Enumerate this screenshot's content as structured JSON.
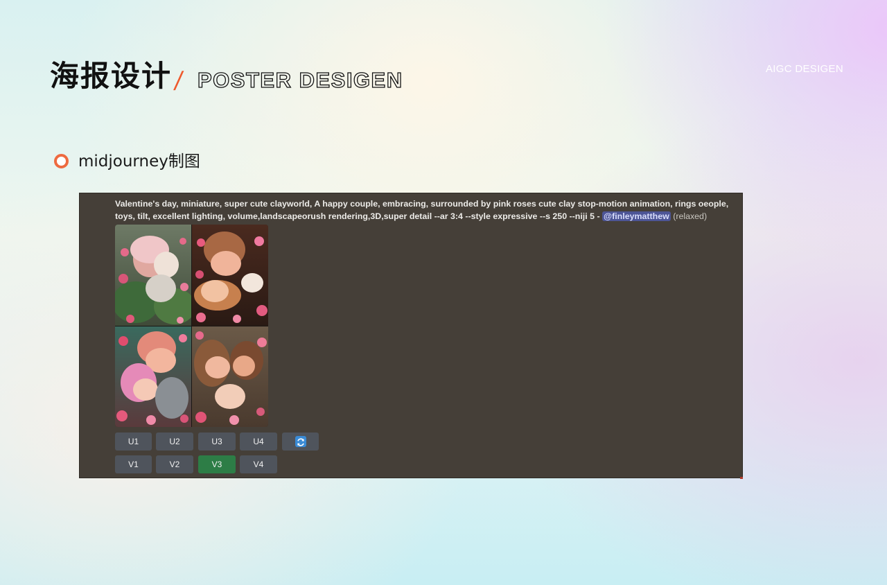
{
  "header": {
    "title_cn": "海报设计",
    "separator": "/",
    "title_en": "POSTER DESIGEN",
    "right_label": "AIGC DESIGEN"
  },
  "section": {
    "title": "midjourney制图"
  },
  "discord": {
    "prompt_text": "Valentine's day, miniature, super cute clayworld, A happy couple, embracing, surrounded by pink roses cute clay stop-motion animation, rings oeople, toys, tilt, excellent lighting, volume,landscapeorush rendering,3D,super detail --ar 3:4 --style expressive --s 250 --niji 5 - ",
    "mention": "@finleymatthew",
    "status": "(relaxed)",
    "upscale_buttons": [
      "U1",
      "U2",
      "U3",
      "U4"
    ],
    "variation_buttons": [
      "V1",
      "V2",
      "V3",
      "V4"
    ],
    "selected_button": "V3",
    "refresh_icon": "refresh-icon"
  }
}
